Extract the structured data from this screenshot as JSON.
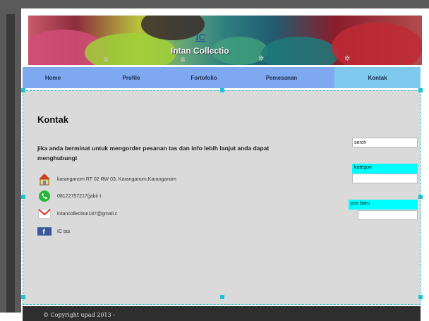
{
  "banner": {
    "logo_link": "IC",
    "title": "Intan Collectio"
  },
  "nav": {
    "items": [
      {
        "label": "Home"
      },
      {
        "label": "Profile"
      },
      {
        "label": "Fortofolio"
      },
      {
        "label": "Pemesanan"
      },
      {
        "label": "Kontak",
        "active": true
      }
    ]
  },
  "main": {
    "title": "Kontak",
    "intro": "jika anda berminat untuk mengorder pesanan tas dan info lebih lanjut anda dapat menghubungi",
    "contacts": [
      {
        "icon": "home-icon",
        "text": "karanganom RT 02 RW 03, Karanganom,Karanganom"
      },
      {
        "icon": "whatsapp-icon",
        "text": "08122757217(jabir t"
      },
      {
        "icon": "gmail-icon",
        "text": "intancollection187@gmail.c"
      },
      {
        "icon": "facebook-icon",
        "text": "IC tas"
      }
    ]
  },
  "sidebar": {
    "search_value": "serch",
    "kategori_label": "kategori",
    "pos_baru_label": "pos baru"
  },
  "footer": {
    "copyright": "© Copyright upad 2013 -"
  },
  "colors": {
    "nav": "#7ea8f0",
    "nav_active": "#7fc8ee",
    "content_bg": "#dadada",
    "cyan_label": "#00ffff",
    "selection": "#27b6c9"
  }
}
